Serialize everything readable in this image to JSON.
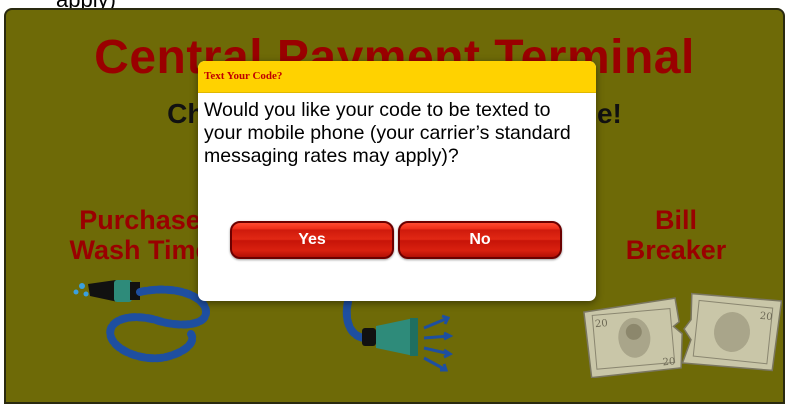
{
  "background": {
    "top_text": "apply)",
    "title": "Central Payment Terminal",
    "subtitle": "Choose how you'd like to Sparkle!",
    "options": [
      {
        "label_line1": "Purchase",
        "label_line2": "Wash Time",
        "icon": "hose-icon"
      },
      {
        "icon": "spray-nozzle-icon"
      },
      {
        "label_line1": "Bill",
        "label_line2": "Breaker",
        "icon": "dollar-bills-icon"
      }
    ]
  },
  "dialog": {
    "title": "Text Your Code?",
    "message": "Would you like your code to be texted to your mobile phone (your carrier’s standard messaging rates may apply)?",
    "yes_label": "Yes",
    "no_label": "No"
  },
  "colors": {
    "kiosk_background": "#6e6a07",
    "title_red": "#9a0000",
    "dialog_header": "#ffd200",
    "button_red": "#d9200f"
  }
}
